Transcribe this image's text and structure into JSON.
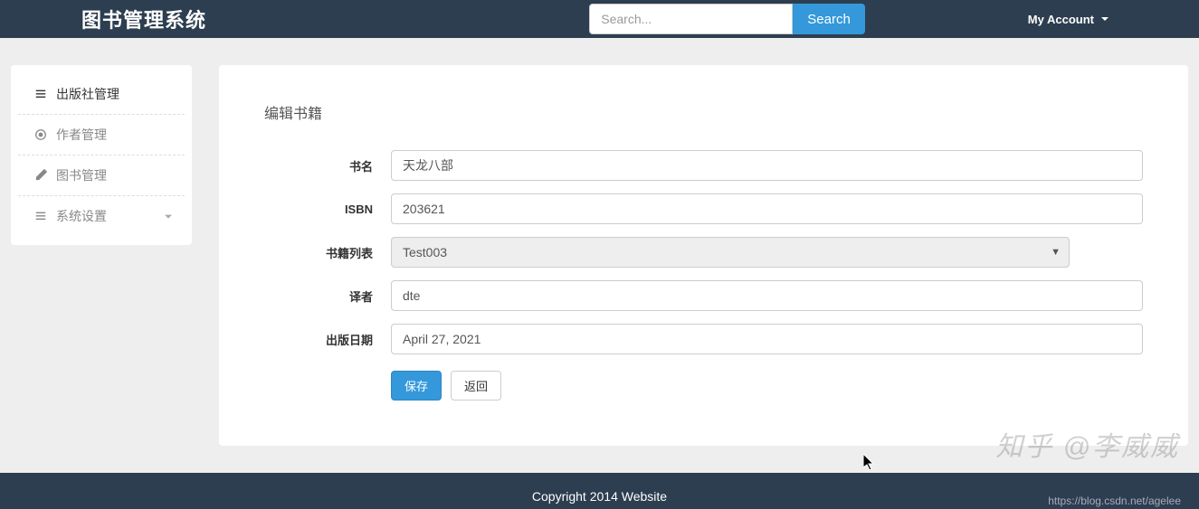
{
  "header": {
    "brand": "图书管理系统",
    "search_placeholder": "Search...",
    "search_button": "Search",
    "account_label": "My Account"
  },
  "sidebar": {
    "items": [
      {
        "label": "出版社管理",
        "icon": "list-icon",
        "active": true
      },
      {
        "label": "作者管理",
        "icon": "target-icon",
        "active": false
      },
      {
        "label": "图书管理",
        "icon": "pencil-icon",
        "active": false
      },
      {
        "label": "系统设置",
        "icon": "list-icon",
        "active": false,
        "has_submenu": true
      }
    ]
  },
  "main": {
    "title": "编辑书籍",
    "form": {
      "fields": {
        "title": {
          "label": "书名",
          "value": "天龙八部"
        },
        "isbn": {
          "label": "ISBN",
          "value": "203621"
        },
        "booklist": {
          "label": "书籍列表",
          "value": "Test003"
        },
        "translator": {
          "label": "译者",
          "value": "dte"
        },
        "pubdate": {
          "label": "出版日期",
          "value": "April 27, 2021"
        }
      },
      "actions": {
        "save": "保存",
        "back": "返回"
      }
    }
  },
  "footer": {
    "copyright": "Copyright 2014 Website",
    "sublink": "https://blog.csdn.net/agelee"
  },
  "watermark": "知乎 @李威威"
}
